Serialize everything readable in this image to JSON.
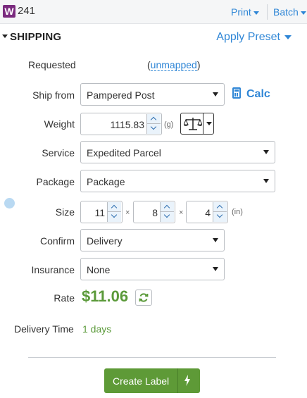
{
  "header": {
    "logo_letter": "W",
    "order_number": "241",
    "print_label": "Print",
    "batch_label": "Batch"
  },
  "section": {
    "title": "SHIPPING",
    "apply_preset_label": "Apply Preset"
  },
  "fields": {
    "requested_label": "Requested",
    "requested_open": "(",
    "requested_value": "unmapped",
    "requested_close": ")",
    "ship_from_label": "Ship from",
    "ship_from_value": "Pampered Post",
    "calc_label": "Calc",
    "weight_label": "Weight",
    "weight_value": "1115.83",
    "weight_unit": "(g)",
    "service_label": "Service",
    "service_value": "Expedited Parcel",
    "package_label": "Package",
    "package_value": "Package",
    "size_label": "Size",
    "size_length": "11",
    "size_width": "8",
    "size_height": "4",
    "size_times_1": "×",
    "size_times_2": "×",
    "size_unit": "(in)",
    "confirm_label": "Confirm",
    "confirm_value": "Delivery",
    "insurance_label": "Insurance",
    "insurance_value": "None",
    "rate_label": "Rate",
    "rate_value": "$11.06",
    "delivery_time_label": "Delivery Time",
    "delivery_time_value": "1 days"
  },
  "actions": {
    "create_label": "Create Label"
  },
  "icons": {
    "logo": "wordpress-w-logo",
    "calc": "calculator-icon",
    "scale": "scale-icon",
    "refresh": "refresh-icon",
    "bolt": "lightning-bolt-icon"
  },
  "colors": {
    "accent_blue": "#2f86d6",
    "rate_green": "#5b9a3a",
    "button_green": "#5e9a37",
    "logo_purple": "#7a2a7e"
  }
}
